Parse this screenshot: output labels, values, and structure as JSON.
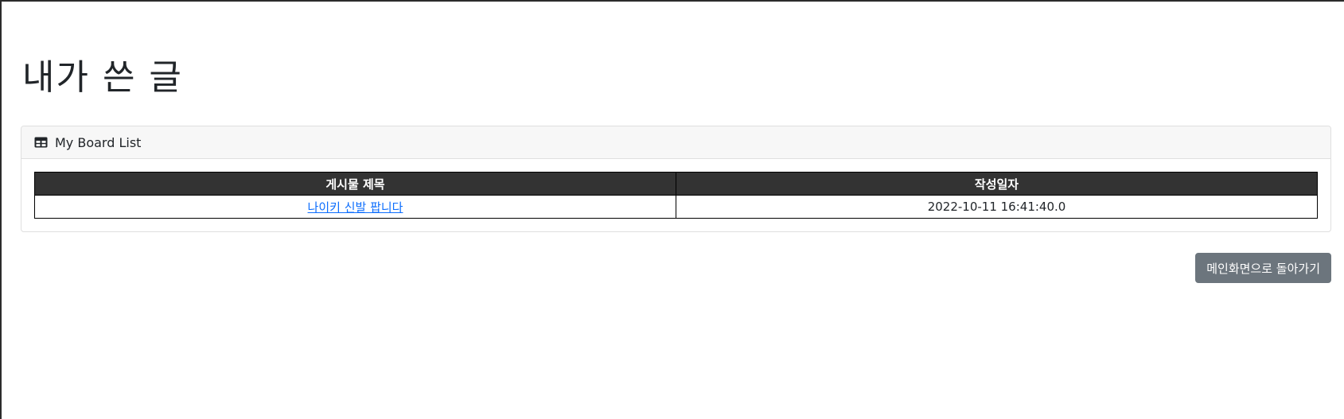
{
  "page": {
    "title": "내가 쓴 글"
  },
  "card": {
    "header_icon": "table-icon",
    "header_label": "My Board List"
  },
  "table": {
    "columns": [
      "게시물 제목",
      "작성일자"
    ],
    "rows": [
      {
        "title": "나이키 신발 팝니다",
        "date": "2022-10-11 16:41:40.0"
      }
    ]
  },
  "actions": {
    "back_label": "메인화면으로 돌아가기"
  },
  "colors": {
    "table_header_bg": "#333333",
    "link": "#0d6efd",
    "button_secondary": "#6c757d",
    "card_header_bg": "#f7f7f7"
  }
}
